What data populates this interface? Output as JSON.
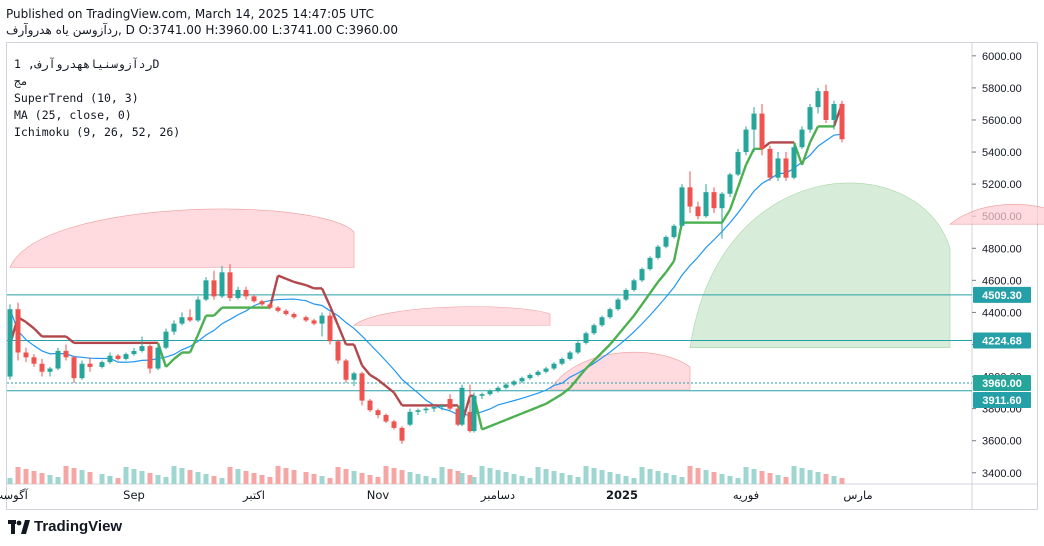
{
  "header": {
    "published": "Published on TradingView.com, March 14, 2025 14:47:05 UTC",
    "ohlc_line": "ﺭﺩﺁﺯﻭﺳﻦ ﻳﺎﻩ ﻫﺪﺭﻭﺁﺭﻑ, D O:3741.00 H:3960.00 L:3741.00 C:3960.00"
  },
  "legend": {
    "symbol": "ﺭﺩﺁﺯﻭﺳﻨﻴﺎﻫﻬﺪﺭﻭﺁﺭﻑ, 1D",
    "exchange": "ﻣﺞ",
    "supertrend": "SuperTrend (10, 3)",
    "ma": "MA (25, close, 0)",
    "ichimoku": "Ichimoku (9, 26, 52, 26)"
  },
  "footer": {
    "brand": "TradingView"
  },
  "colors": {
    "up": "#26a69a",
    "down": "#ef5350",
    "supertrend_up": "#4caf50",
    "supertrend_down": "#b2474b",
    "ma": "#2196f3",
    "cloud_bull": "#c8e6c9",
    "cloud_bear": "#ffcdd2",
    "hline": "#26a0a8"
  },
  "chart_data": {
    "type": "candlestick",
    "y_axis": {
      "range": [
        3330,
        6080
      ],
      "ticks": [
        3400,
        3600,
        3800,
        4000,
        4200,
        4400,
        4600,
        4800,
        5000,
        5200,
        5400,
        5600,
        5800,
        6000
      ],
      "tick_labels": [
        "3400.00",
        "3600.00",
        "3800.00",
        "4000.00",
        "4200.00",
        "4400.00",
        "4600.00",
        "4800.00",
        "5000.00",
        "5200.00",
        "5400.00",
        "5600.00",
        "5800.00",
        "6000.00"
      ],
      "price_tags": [
        {
          "value": 4509.3,
          "label": "4509.30"
        },
        {
          "value": 4224.68,
          "label": "4224.68"
        },
        {
          "value": 3960.0,
          "label": "3960.00"
        },
        {
          "value": 3911.6,
          "label": "3911.60"
        }
      ]
    },
    "x_axis": {
      "labels": [
        {
          "text": "آگوست",
          "day": 0
        },
        {
          "text": "Sep",
          "day": 31
        },
        {
          "text": "اکتبر",
          "day": 61
        },
        {
          "text": "Nov",
          "day": 92
        },
        {
          "text": "دسامبر",
          "day": 122
        },
        {
          "text": "2025",
          "day": 153
        },
        {
          "text": "فوریه",
          "day": 184
        },
        {
          "text": "مارس",
          "day": 212
        }
      ],
      "start_date": "2024-08-01",
      "end_date": "2025-03-14"
    },
    "candles": [
      {
        "date": "2024-08-01",
        "o": 4000,
        "h": 4450,
        "l": 3980,
        "c": 4420
      },
      {
        "date": "2024-08-03",
        "o": 4420,
        "h": 4460,
        "l": 4100,
        "c": 4150
      },
      {
        "date": "2024-08-05",
        "o": 4150,
        "h": 4180,
        "l": 4090,
        "c": 4120
      },
      {
        "date": "2024-08-07",
        "o": 4120,
        "h": 4140,
        "l": 4060,
        "c": 4080
      },
      {
        "date": "2024-08-09",
        "o": 4080,
        "h": 4110,
        "l": 4000,
        "c": 4030
      },
      {
        "date": "2024-08-11",
        "o": 4030,
        "h": 4060,
        "l": 4000,
        "c": 4050
      },
      {
        "date": "2024-08-13",
        "o": 4050,
        "h": 4180,
        "l": 4040,
        "c": 4160
      },
      {
        "date": "2024-08-15",
        "o": 4160,
        "h": 4200,
        "l": 4100,
        "c": 4120
      },
      {
        "date": "2024-08-17",
        "o": 4120,
        "h": 4130,
        "l": 3960,
        "c": 3990
      },
      {
        "date": "2024-08-19",
        "o": 3990,
        "h": 4100,
        "l": 3980,
        "c": 4080
      },
      {
        "date": "2024-08-21",
        "o": 4080,
        "h": 4120,
        "l": 4030,
        "c": 4060
      },
      {
        "date": "2024-08-24",
        "o": 4060,
        "h": 4100,
        "l": 4050,
        "c": 4090
      },
      {
        "date": "2024-08-26",
        "o": 4090,
        "h": 4150,
        "l": 4080,
        "c": 4130
      },
      {
        "date": "2024-08-28",
        "o": 4130,
        "h": 4140,
        "l": 4100,
        "c": 4110
      },
      {
        "date": "2024-08-30",
        "o": 4110,
        "h": 4150,
        "l": 4100,
        "c": 4140
      },
      {
        "date": "2024-09-01",
        "o": 4140,
        "h": 4180,
        "l": 4130,
        "c": 4160
      },
      {
        "date": "2024-09-03",
        "o": 4160,
        "h": 4250,
        "l": 4150,
        "c": 4190
      },
      {
        "date": "2024-09-05",
        "o": 4190,
        "h": 4200,
        "l": 4020,
        "c": 4050
      },
      {
        "date": "2024-09-07",
        "o": 4050,
        "h": 4200,
        "l": 4040,
        "c": 4180
      },
      {
        "date": "2024-09-09",
        "o": 4180,
        "h": 4300,
        "l": 4170,
        "c": 4280
      },
      {
        "date": "2024-09-11",
        "o": 4280,
        "h": 4350,
        "l": 4260,
        "c": 4330
      },
      {
        "date": "2024-09-13",
        "o": 4330,
        "h": 4400,
        "l": 4320,
        "c": 4370
      },
      {
        "date": "2024-09-15",
        "o": 4370,
        "h": 4420,
        "l": 4340,
        "c": 4350
      },
      {
        "date": "2024-09-17",
        "o": 4350,
        "h": 4500,
        "l": 4340,
        "c": 4480
      },
      {
        "date": "2024-09-19",
        "o": 4480,
        "h": 4620,
        "l": 4470,
        "c": 4600
      },
      {
        "date": "2024-09-21",
        "o": 4600,
        "h": 4660,
        "l": 4480,
        "c": 4500
      },
      {
        "date": "2024-09-23",
        "o": 4500,
        "h": 4690,
        "l": 4490,
        "c": 4650
      },
      {
        "date": "2024-09-25",
        "o": 4650,
        "h": 4700,
        "l": 4470,
        "c": 4490
      },
      {
        "date": "2024-09-27",
        "o": 4490,
        "h": 4560,
        "l": 4480,
        "c": 4540
      },
      {
        "date": "2024-09-29",
        "o": 4540,
        "h": 4560,
        "l": 4480,
        "c": 4500
      },
      {
        "date": "2024-10-01",
        "o": 4500,
        "h": 4510,
        "l": 4460,
        "c": 4470
      },
      {
        "date": "2024-10-03",
        "o": 4470,
        "h": 4480,
        "l": 4440,
        "c": 4450
      },
      {
        "date": "2024-10-05",
        "o": 4450,
        "h": 4460,
        "l": 4420,
        "c": 4430
      },
      {
        "date": "2024-10-07",
        "o": 4430,
        "h": 4440,
        "l": 4400,
        "c": 4410
      },
      {
        "date": "2024-10-09",
        "o": 4410,
        "h": 4420,
        "l": 4380,
        "c": 4390
      },
      {
        "date": "2024-10-11",
        "o": 4390,
        "h": 4400,
        "l": 4360,
        "c": 4370
      },
      {
        "date": "2024-10-14",
        "o": 4370,
        "h": 4380,
        "l": 4340,
        "c": 4350
      },
      {
        "date": "2024-10-16",
        "o": 4350,
        "h": 4360,
        "l": 4320,
        "c": 4330
      },
      {
        "date": "2024-10-18",
        "o": 4330,
        "h": 4400,
        "l": 4250,
        "c": 4380
      },
      {
        "date": "2024-10-20",
        "o": 4380,
        "h": 4400,
        "l": 4200,
        "c": 4220
      },
      {
        "date": "2024-10-22",
        "o": 4220,
        "h": 4230,
        "l": 4080,
        "c": 4100
      },
      {
        "date": "2024-10-24",
        "o": 4100,
        "h": 4110,
        "l": 3960,
        "c": 3980
      },
      {
        "date": "2024-10-26",
        "o": 3980,
        "h": 4030,
        "l": 3940,
        "c": 4020
      },
      {
        "date": "2024-10-28",
        "o": 4020,
        "h": 4030,
        "l": 3820,
        "c": 3850
      },
      {
        "date": "2024-10-30",
        "o": 3850,
        "h": 3860,
        "l": 3780,
        "c": 3790
      },
      {
        "date": "2024-11-01",
        "o": 3790,
        "h": 3800,
        "l": 3740,
        "c": 3760
      },
      {
        "date": "2024-11-03",
        "o": 3760,
        "h": 3770,
        "l": 3710,
        "c": 3720
      },
      {
        "date": "2024-11-05",
        "o": 3720,
        "h": 3730,
        "l": 3670,
        "c": 3680
      },
      {
        "date": "2024-11-07",
        "o": 3680,
        "h": 3690,
        "l": 3580,
        "c": 3600
      },
      {
        "date": "2024-11-09",
        "o": 3700,
        "h": 3800,
        "l": 3690,
        "c": 3780
      },
      {
        "date": "2024-11-11",
        "o": 3780,
        "h": 3800,
        "l": 3760,
        "c": 3790
      },
      {
        "date": "2024-11-13",
        "o": 3790,
        "h": 3810,
        "l": 3770,
        "c": 3800
      },
      {
        "date": "2024-11-15",
        "o": 3800,
        "h": 3820,
        "l": 3780,
        "c": 3810
      },
      {
        "date": "2024-11-17",
        "o": 3810,
        "h": 3830,
        "l": 3790,
        "c": 3820
      },
      {
        "date": "2024-11-19",
        "o": 3860,
        "h": 3890,
        "l": 3790,
        "c": 3800
      },
      {
        "date": "2024-11-21",
        "o": 3800,
        "h": 3820,
        "l": 3690,
        "c": 3700
      },
      {
        "date": "2024-11-22",
        "o": 3700,
        "h": 3950,
        "l": 3690,
        "c": 3930
      },
      {
        "date": "2024-11-24",
        "o": 3780,
        "h": 3950,
        "l": 3650,
        "c": 3660
      },
      {
        "date": "2024-11-25",
        "o": 3660,
        "h": 3900,
        "l": 3650,
        "c": 3880
      },
      {
        "date": "2024-11-27",
        "o": 3880,
        "h": 3900,
        "l": 3860,
        "c": 3890
      },
      {
        "date": "2024-11-29",
        "o": 3890,
        "h": 3920,
        "l": 3880,
        "c": 3910
      },
      {
        "date": "2024-12-01",
        "o": 3910,
        "h": 3940,
        "l": 3900,
        "c": 3930
      },
      {
        "date": "2024-12-03",
        "o": 3930,
        "h": 3960,
        "l": 3920,
        "c": 3950
      },
      {
        "date": "2024-12-05",
        "o": 3950,
        "h": 3980,
        "l": 3940,
        "c": 3970
      },
      {
        "date": "2024-12-07",
        "o": 3970,
        "h": 4000,
        "l": 3960,
        "c": 3990
      },
      {
        "date": "2024-12-09",
        "o": 3990,
        "h": 4020,
        "l": 3980,
        "c": 4010
      },
      {
        "date": "2024-12-11",
        "o": 4010,
        "h": 4040,
        "l": 4000,
        "c": 4030
      },
      {
        "date": "2024-12-13",
        "o": 4030,
        "h": 4060,
        "l": 4020,
        "c": 4050
      },
      {
        "date": "2024-12-15",
        "o": 4050,
        "h": 4090,
        "l": 4040,
        "c": 4080
      },
      {
        "date": "2024-12-17",
        "o": 4080,
        "h": 4120,
        "l": 4070,
        "c": 4110
      },
      {
        "date": "2024-12-19",
        "o": 4110,
        "h": 4160,
        "l": 4100,
        "c": 4150
      },
      {
        "date": "2024-12-21",
        "o": 4150,
        "h": 4220,
        "l": 4140,
        "c": 4210
      },
      {
        "date": "2024-12-23",
        "o": 4210,
        "h": 4280,
        "l": 4200,
        "c": 4270
      },
      {
        "date": "2024-12-25",
        "o": 4270,
        "h": 4330,
        "l": 4260,
        "c": 4320
      },
      {
        "date": "2024-12-27",
        "o": 4320,
        "h": 4380,
        "l": 4310,
        "c": 4370
      },
      {
        "date": "2024-12-29",
        "o": 4370,
        "h": 4430,
        "l": 4360,
        "c": 4420
      },
      {
        "date": "2024-12-31",
        "o": 4420,
        "h": 4490,
        "l": 4410,
        "c": 4480
      },
      {
        "date": "2025-01-02",
        "o": 4480,
        "h": 4550,
        "l": 4470,
        "c": 4540
      },
      {
        "date": "2025-01-04",
        "o": 4540,
        "h": 4610,
        "l": 4530,
        "c": 4600
      },
      {
        "date": "2025-01-06",
        "o": 4600,
        "h": 4680,
        "l": 4590,
        "c": 4670
      },
      {
        "date": "2025-01-08",
        "o": 4670,
        "h": 4750,
        "l": 4660,
        "c": 4740
      },
      {
        "date": "2025-01-10",
        "o": 4740,
        "h": 4820,
        "l": 4730,
        "c": 4810
      },
      {
        "date": "2025-01-12",
        "o": 4810,
        "h": 4880,
        "l": 4800,
        "c": 4870
      },
      {
        "date": "2025-01-14",
        "o": 4870,
        "h": 4950,
        "l": 4860,
        "c": 4940
      },
      {
        "date": "2025-01-16",
        "o": 4940,
        "h": 5200,
        "l": 4930,
        "c": 5180
      },
      {
        "date": "2025-01-18",
        "o": 5180,
        "h": 5280,
        "l": 5020,
        "c": 5060
      },
      {
        "date": "2025-01-20",
        "o": 5060,
        "h": 5090,
        "l": 4980,
        "c": 5000
      },
      {
        "date": "2025-01-22",
        "o": 5000,
        "h": 5200,
        "l": 4990,
        "c": 5150
      },
      {
        "date": "2025-01-24",
        "o": 5150,
        "h": 5180,
        "l": 5020,
        "c": 5050
      },
      {
        "date": "2025-01-26",
        "o": 5050,
        "h": 5150,
        "l": 4860,
        "c": 5140
      },
      {
        "date": "2025-01-28",
        "o": 5140,
        "h": 5270,
        "l": 5120,
        "c": 5260
      },
      {
        "date": "2025-01-30",
        "o": 5260,
        "h": 5420,
        "l": 5250,
        "c": 5400
      },
      {
        "date": "2025-02-01",
        "o": 5400,
        "h": 5560,
        "l": 5380,
        "c": 5540
      },
      {
        "date": "2025-02-03",
        "o": 5540,
        "h": 5680,
        "l": 5400,
        "c": 5640
      },
      {
        "date": "2025-02-05",
        "o": 5640,
        "h": 5700,
        "l": 5380,
        "c": 5420
      },
      {
        "date": "2025-02-07",
        "o": 5420,
        "h": 5440,
        "l": 5220,
        "c": 5240
      },
      {
        "date": "2025-02-09",
        "o": 5240,
        "h": 5400,
        "l": 5220,
        "c": 5360
      },
      {
        "date": "2025-02-11",
        "o": 5360,
        "h": 5400,
        "l": 5220,
        "c": 5240
      },
      {
        "date": "2025-02-13",
        "o": 5240,
        "h": 5450,
        "l": 5230,
        "c": 5430
      },
      {
        "date": "2025-02-15",
        "o": 5430,
        "h": 5560,
        "l": 5420,
        "c": 5540
      },
      {
        "date": "2025-02-17",
        "o": 5540,
        "h": 5700,
        "l": 5520,
        "c": 5680
      },
      {
        "date": "2025-02-19",
        "o": 5680,
        "h": 5800,
        "l": 5640,
        "c": 5780
      },
      {
        "date": "2025-02-21",
        "o": 5780,
        "h": 5820,
        "l": 5580,
        "c": 5600
      },
      {
        "date": "2025-02-23",
        "o": 5600,
        "h": 5720,
        "l": 5540,
        "c": 5700
      },
      {
        "date": "2025-02-25",
        "o": 5700,
        "h": 5720,
        "l": 5460,
        "c": 5480
      }
    ],
    "note_series_truncated_for_brevity": false
  }
}
